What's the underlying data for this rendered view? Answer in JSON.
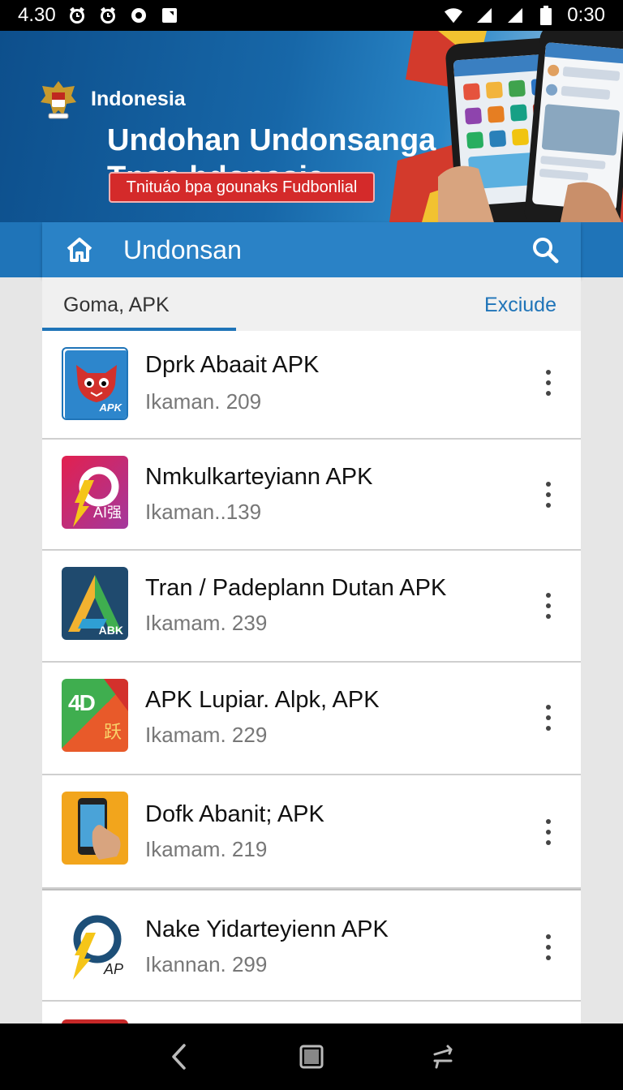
{
  "status_bar": {
    "time_left": "4.30",
    "time_right": "0:30",
    "icons_left": [
      "alarm-icon",
      "alarm-icon",
      "record-icon",
      "notification-icon"
    ],
    "icons_right": [
      "wifi-icon",
      "signal-icon",
      "signal-icon",
      "battery-icon"
    ]
  },
  "banner": {
    "country": "Indonesia",
    "headline_line1": "Undohan Undonsanga",
    "headline_line2": "Tnan hdonesia",
    "cta_label": "Tnituáo bpa gounaks Fudbonlial"
  },
  "toolbar": {
    "title": "Undonsan",
    "home_icon": "home-icon",
    "search_icon": "search-icon"
  },
  "tabs": {
    "active": "Goma, APK",
    "right": "Exciude"
  },
  "apps": [
    {
      "name": "Dprk Abaait APK",
      "sub": "Ikaman. 209",
      "icon_text": "APK"
    },
    {
      "name": "Nmkulkarteyiann APK",
      "sub": "Ikaman..139",
      "icon_text": "AI强"
    },
    {
      "name": "Tran / Padeplann Dutan APK",
      "sub": "Ikamam. 239",
      "icon_text": "ABK"
    },
    {
      "name": "APK Lupiar. Alpk, APK",
      "sub": "Ikamam. 229",
      "icon_text": "4D",
      "icon_text2": "跃"
    },
    {
      "name": "Dofk Abanit; APK",
      "sub": "Ikamam. 219",
      "icon_text": ""
    },
    {
      "name": "Nake Yidarteyienn APK",
      "sub": "Ikannan. 299",
      "icon_text": "AP"
    }
  ],
  "colors": {
    "primary": "#1f74b8",
    "cta": "#d42a2a"
  },
  "nav": [
    "back-icon",
    "home-square-icon",
    "recents-icon"
  ]
}
